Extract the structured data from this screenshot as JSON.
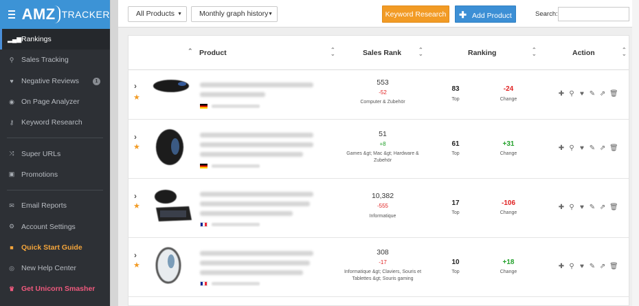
{
  "brand": {
    "logo_main": "AMZ",
    "logo_sub": "TRACKER"
  },
  "sidebar": {
    "items": [
      {
        "label": "Rankings",
        "icon": "bar-chart-icon"
      },
      {
        "label": "Sales Tracking",
        "icon": "search-icon"
      },
      {
        "label": "Negative Reviews",
        "icon": "heart-icon",
        "badge": "1"
      },
      {
        "label": "On Page Analyzer",
        "icon": "eye-icon"
      },
      {
        "label": "Keyword Research",
        "icon": "key-icon"
      },
      {
        "label": "Super URLs",
        "icon": "shuffle-icon"
      },
      {
        "label": "Promotions",
        "icon": "gift-icon"
      },
      {
        "label": "Email Reports",
        "icon": "envelope-icon"
      },
      {
        "label": "Account Settings",
        "icon": "gear-icon"
      },
      {
        "label": "Quick Start Guide",
        "icon": "video-icon"
      },
      {
        "label": "New Help Center",
        "icon": "help-icon"
      },
      {
        "label": "Get Unicorn Smasher",
        "icon": "crown-icon"
      }
    ]
  },
  "toolbar": {
    "filter_products": "All Products",
    "graph_history": "Monthly graph history",
    "keyword_research_button": "Keyword Research",
    "add_product_button": "Add Product",
    "search_label": "Search:",
    "search_value": ""
  },
  "table": {
    "columns": {
      "product": "Product",
      "sales_rank": "Sales Rank",
      "ranking": "Ranking",
      "action": "Action"
    },
    "top_label": "Top",
    "change_label": "Change",
    "rows": [
      {
        "sales_rank": "553",
        "sales_rank_delta": "-52",
        "category": "Computer & Zubehör",
        "top": "83",
        "change": "-24"
      },
      {
        "sales_rank": "51",
        "sales_rank_delta": "+8",
        "category": "Games &gt; Mac &gt; Hardware & Zubehör",
        "top": "61",
        "change": "+31"
      },
      {
        "sales_rank": "10,382",
        "sales_rank_delta": "-555",
        "category": "Informatique",
        "top": "17",
        "change": "-106"
      },
      {
        "sales_rank": "308",
        "sales_rank_delta": "-17",
        "category": "Informatique &gt; Claviers, Souris et Tablettes &gt; Souris gaming",
        "top": "10",
        "change": "+18"
      }
    ]
  },
  "colors": {
    "sidebar_bg": "#2d3035",
    "brand_bg": "#3c93d6",
    "orange": "#f29b25",
    "blue": "#3c8fd5",
    "negative": "#e02020",
    "positive": "#22a02a"
  }
}
